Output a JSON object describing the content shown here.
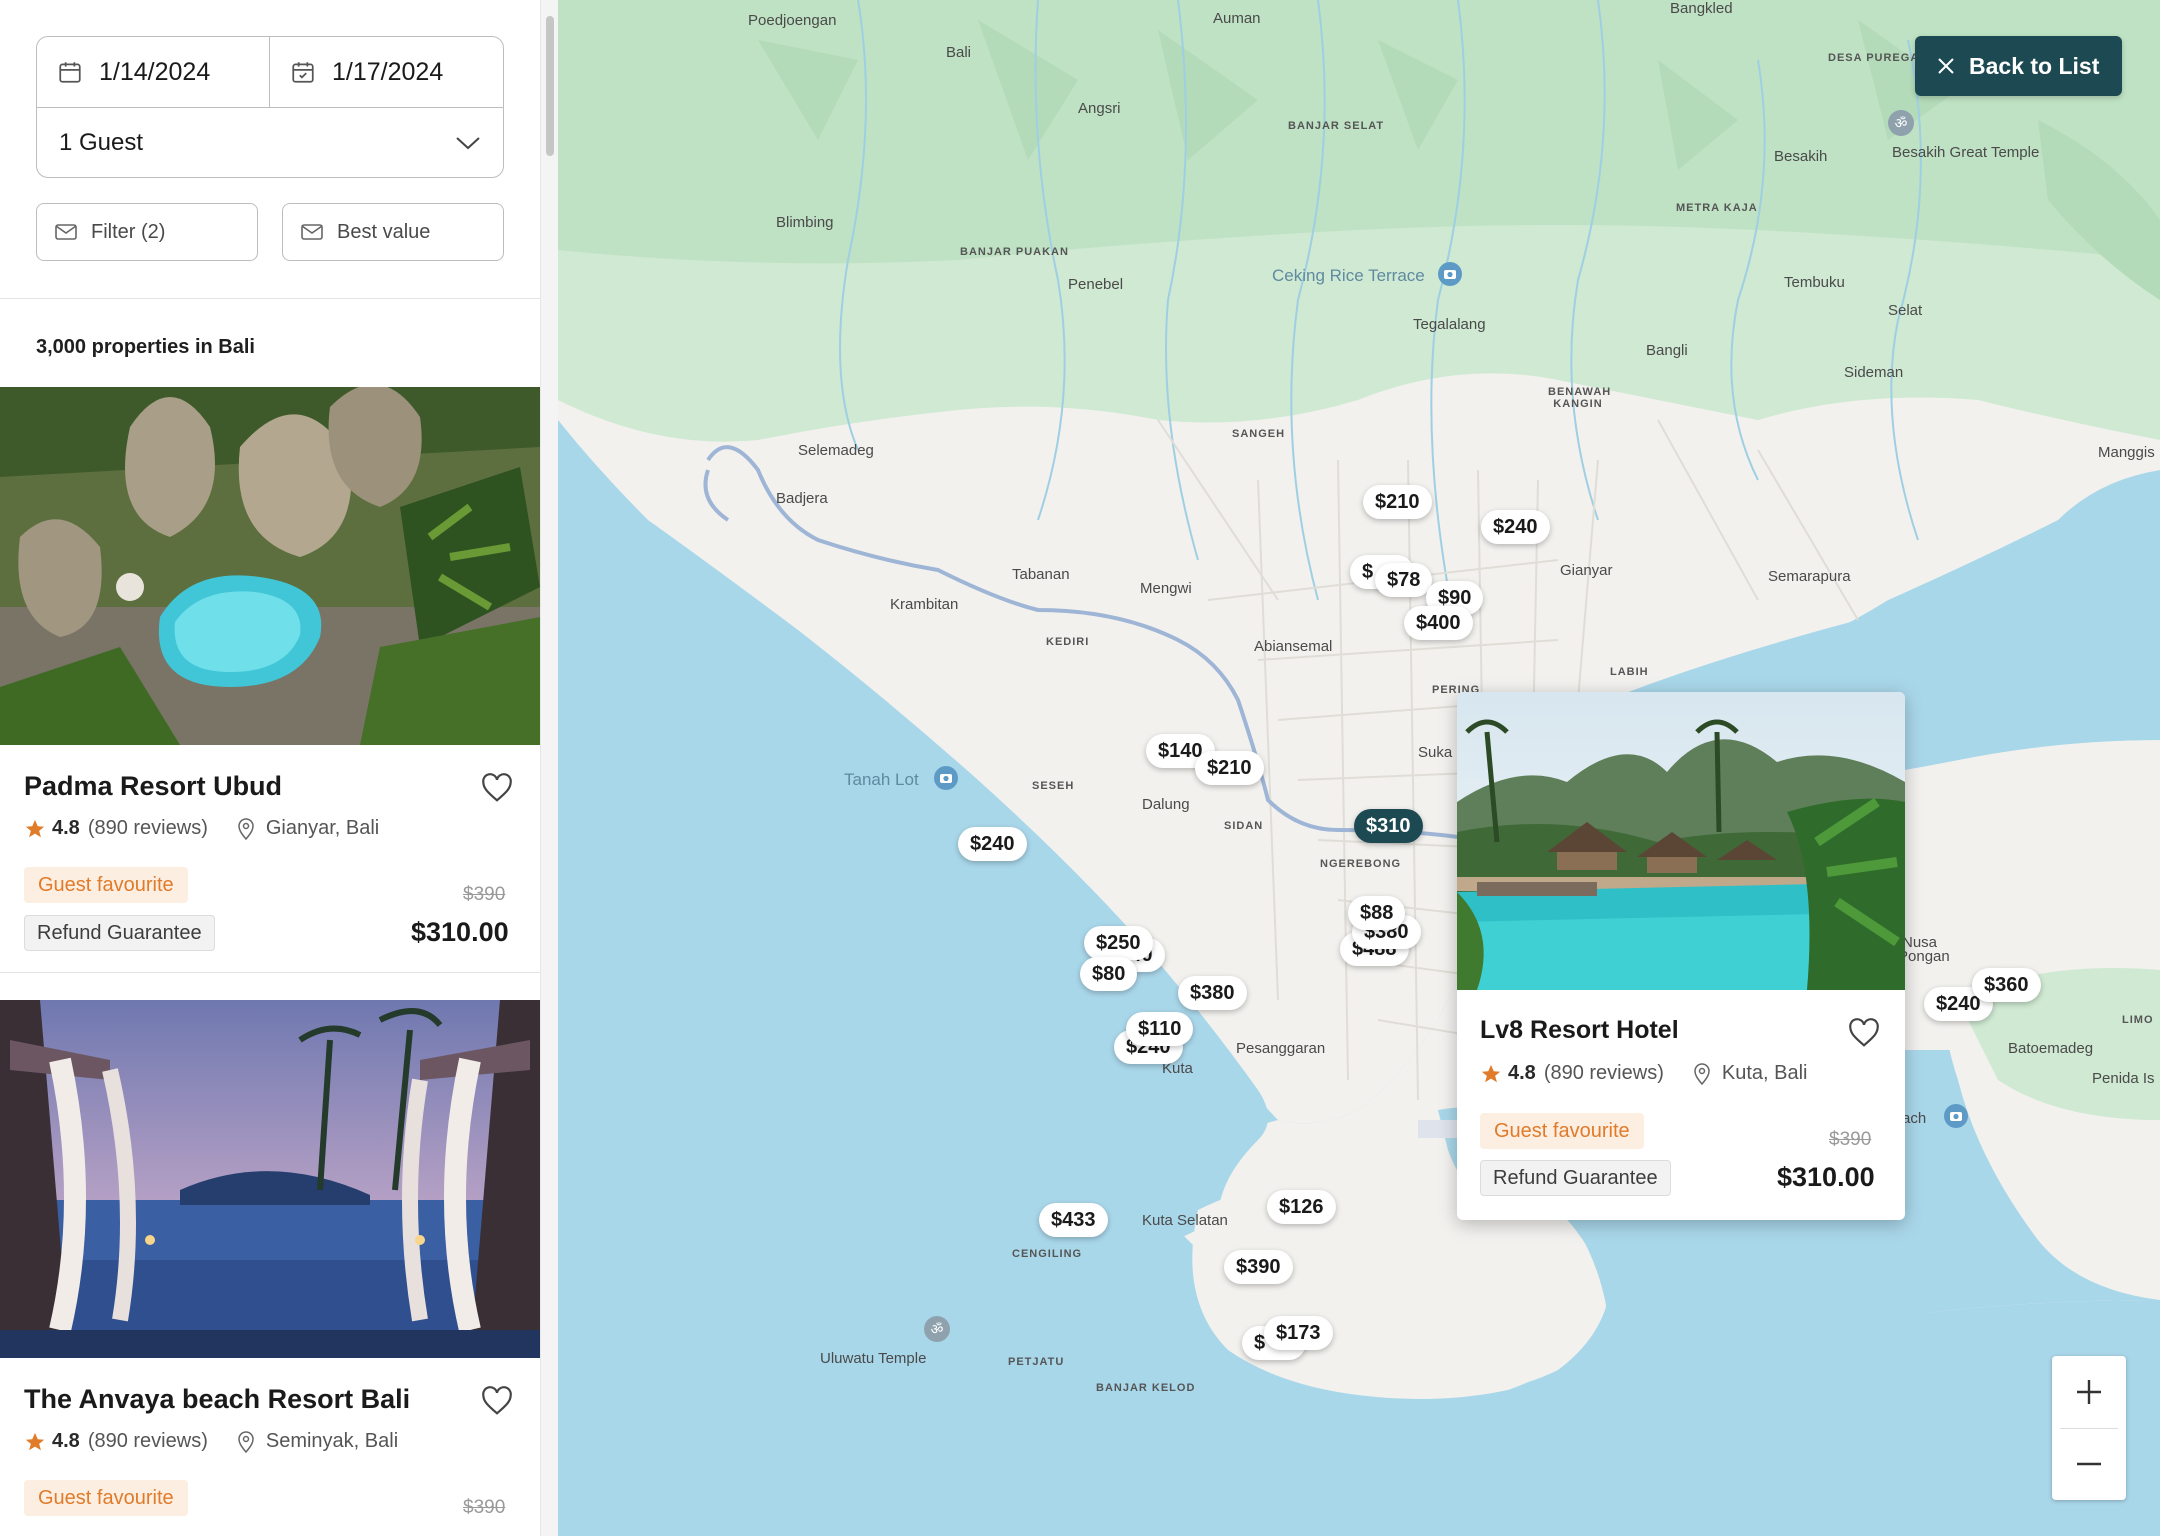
{
  "search": {
    "checkin": "1/14/2024",
    "checkout": "1/17/2024",
    "guests": "1 Guest",
    "filter_label": "Filter (2)",
    "sort_label": "Best value"
  },
  "results": {
    "count_text": "3,000 properties in Bali"
  },
  "listings": [
    {
      "name": "Padma Resort Ubud",
      "rating": "4.8",
      "reviews": "(890 reviews)",
      "location": "Gianyar, Bali",
      "badge": "Guest favourite",
      "guarantee": "Refund Guarantee",
      "old_price": "$390",
      "price": "$310.00"
    },
    {
      "name": "The Anvaya beach Resort Bali",
      "rating": "4.8",
      "reviews": "(890 reviews)",
      "location": "Seminyak, Bali",
      "badge": "Guest favourite",
      "old_price": "$390"
    }
  ],
  "map": {
    "back_label": "Back to List",
    "places": [
      "Poedjoengan",
      "Auman",
      "Bangkled",
      "Bali",
      "Angsri",
      "BANJAR SELAT",
      "DESA PUREGAI",
      "Besakih",
      "Besakih Great Temple",
      "Blimbing",
      "BANJAR PUAKAN",
      "Penebel",
      "Ceking Rice Terrace",
      "METRA KAJA",
      "Tembuku",
      "Tegalalang",
      "Bangli",
      "Selat",
      "BENAWAH KANGIN",
      "Sideman",
      "SANGEH",
      "Selemadeg",
      "Badjera",
      "Manggis",
      "Gianyar",
      "Semarapura",
      "Tabanan",
      "Mengwi",
      "Krambitan",
      "KEDIRI",
      "Abiansemal",
      "LABIH",
      "PERING",
      "Tanah Lot",
      "SESEH",
      "Dalung",
      "SIDAN",
      "NGEREBONG",
      "Suka",
      "Pesanggaran",
      "Kuta",
      "Kuta Selatan",
      "CENGILING",
      "Uluwatu Temple",
      "PETJATU",
      "BANJAR KELOD",
      "Nusa",
      "Pongan",
      "LIMO",
      "Batoemadeg",
      "Penida Is",
      "ach"
    ],
    "pins": [
      "$210",
      "$240",
      "$78",
      "$90",
      "$400",
      "$140",
      "$210",
      "$310",
      "$240",
      "$88",
      "$380",
      "$488",
      "$250",
      "$240",
      "$80",
      "$380",
      "$110",
      "$240",
      "$433",
      "$126",
      "$390",
      "$173",
      "$240",
      "$360"
    ],
    "active_pin": "$310"
  },
  "popup": {
    "name": "Lv8 Resort Hotel",
    "rating": "4.8",
    "reviews": "(890 reviews)",
    "location": "Kuta, Bali",
    "badge": "Guest favourite",
    "guarantee": "Refund Guarantee",
    "old_price": "$390",
    "price": "$310.00"
  },
  "colors": {
    "accent": "#1d4a52",
    "badge_text": "#e07b2a",
    "badge_bg": "#fdeee2",
    "star": "#e07b2a",
    "water": "#a9d7ea",
    "land": "#f2f1ee",
    "vegetation": "#cfe9d2"
  },
  "icons": {
    "calendar": "calendar-icon",
    "calendar_check": "calendar-check-icon",
    "chevron": "chevron-down-icon",
    "filter": "mail-icon",
    "heart": "heart-icon",
    "star": "star-icon",
    "pin": "location-pin-icon",
    "close": "close-icon",
    "plus": "zoom-in-icon",
    "minus": "zoom-out-icon"
  }
}
